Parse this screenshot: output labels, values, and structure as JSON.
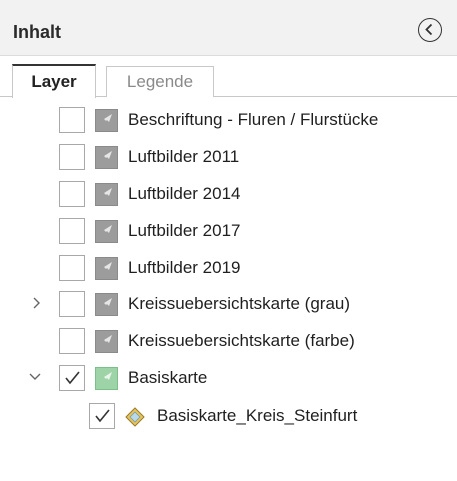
{
  "panel": {
    "title": "Inhalt",
    "collapse_icon": "chevron-left-circle-icon"
  },
  "tabs": [
    {
      "label": "Layer",
      "active": true
    },
    {
      "label": "Legende",
      "active": false
    }
  ],
  "layers": [
    {
      "label": "Beschriftung - Fluren / Flurstücke",
      "checked": false
    },
    {
      "label": "Luftbilder 2011",
      "checked": false
    },
    {
      "label": "Luftbilder 2014",
      "checked": false
    },
    {
      "label": "Luftbilder 2017",
      "checked": false
    },
    {
      "label": "Luftbilder 2019",
      "checked": false
    },
    {
      "label": "Kreissuebersichtskarte (grau)",
      "checked": false,
      "expandable": true,
      "expanded": false
    },
    {
      "label": "Kreissuebersichtskarte (farbe)",
      "checked": false
    },
    {
      "label": "Basiskarte",
      "checked": true,
      "expandable": true,
      "expanded": true,
      "children": [
        {
          "label": "Basiskarte_Kreis_Steinfurt",
          "checked": true,
          "icon": "diamond-layer-icon"
        }
      ]
    }
  ],
  "colors": {
    "header_bg": "#f2f2f2",
    "icon_grey": "#9c9c9c",
    "icon_green": "#9ed3a8",
    "diamond": "#e8c65a"
  }
}
